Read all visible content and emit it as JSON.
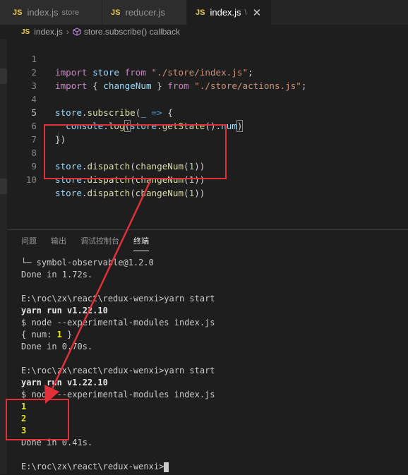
{
  "tabs": [
    {
      "badge": "JS",
      "label": "index.js",
      "desc": "store",
      "active": false
    },
    {
      "badge": "JS",
      "label": "reducer.js",
      "desc": "",
      "active": false
    },
    {
      "badge": "JS",
      "label": "index.js",
      "desc": "\\",
      "active": true
    }
  ],
  "tab_close_glyph": "✕",
  "breadcrumb": {
    "file_badge": "JS",
    "file": "index.js",
    "symbol": "store.subscribe() callback"
  },
  "editor": {
    "line_numbers": [
      "1",
      "2",
      "3",
      "4",
      "5",
      "6",
      "7",
      "8",
      "9",
      "10"
    ],
    "line1": {
      "kw": "import",
      "v": "store",
      "from": "from",
      "str": "\"./store/index.js\"",
      "end": ";"
    },
    "line2": {
      "kw": "import",
      "open": "{",
      "v": "changeNum",
      "close": "}",
      "from": "from",
      "str": "\"./store/actions.js\"",
      "end": ";"
    },
    "line4": {
      "obj": "store",
      "dot": ".",
      "fn": "subscribe",
      "open": "(",
      "param": "_",
      "arrow": "=>",
      "brace": "{"
    },
    "line5": {
      "obj": "console",
      "dot": ".",
      "fn": "log",
      "open": "(",
      "obj2": "store",
      "dot2": ".",
      "fn2": "getState",
      "call": "()",
      "dot3": ".",
      "prop": "num",
      "close": ")"
    },
    "line6": {
      "text": "})"
    },
    "dispatch": {
      "obj": "store",
      "dot": ".",
      "fn": "dispatch",
      "open": "(",
      "fn2": "changeNum",
      "open2": "(",
      "num": "1",
      "close": "))"
    }
  },
  "panel_tabs": [
    "问题",
    "输出",
    "调试控制台",
    "终端"
  ],
  "terminal": {
    "l1": "└─ symbol-observable@1.2.0",
    "l2": "Done in 1.72s.",
    "l3": "E:\\roc\\zx\\react\\redux-wenxi>yarn start",
    "l4": "yarn run v1.22.10",
    "l5": "$ node --experimental-modules index.js",
    "l6a": "{ num: ",
    "l6b": "1",
    "l6c": " }",
    "l7": "Done in 0.70s.",
    "l8": "E:\\roc\\zx\\react\\redux-wenxi>yarn start",
    "l9": "yarn run v1.22.10",
    "l10": "$ node --experimental-modules index.js",
    "out1": "1",
    "out2": "2",
    "out3": "3",
    "l11": "Done in 0.41s.",
    "prompt": "E:\\roc\\zx\\react\\redux-wenxi>"
  },
  "colors": {
    "annotation": "#e0313a",
    "js_badge": "#e8c84a"
  }
}
